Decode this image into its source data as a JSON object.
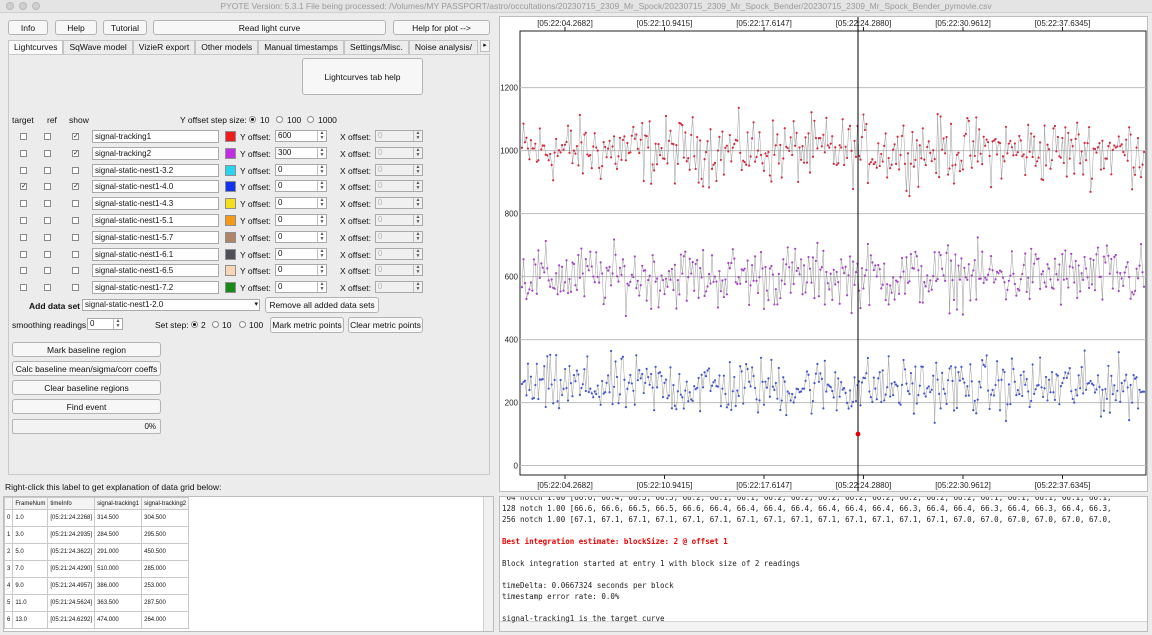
{
  "window": {
    "title": "PYOTE Version: 5.3.1  File being processed: /Volumes/MY PASSPORT/astro/occultations/20230715_2309_Mr_Spock/20230715_2309_Mr_Spock_Bender/20230715_2309_Mr_Spock_Bender_pymovie.csv"
  },
  "toolbar": {
    "info": "Info",
    "help": "Help",
    "tutorial": "Tutorial",
    "read_light_curve": "Read light curve",
    "help_for_plot": "Help for plot -->"
  },
  "tabs": [
    "Lightcurves",
    "SqWave model",
    "VizieR export",
    "Other models",
    "Manual timestamps",
    "Settings/Misc.",
    "Noise analysis/"
  ],
  "lightcurves": {
    "tab_help": "Lightcurves tab help",
    "col_target": "target",
    "col_ref": "ref",
    "col_show": "show",
    "y_offset_step_label": "Y offset step size:",
    "y_step_options": [
      "10",
      "100",
      "1000"
    ],
    "y_step_selected": "10",
    "y_offset_label": "Y offset:",
    "x_offset_label": "X offset:",
    "rows": [
      {
        "name": "signal-tracking1",
        "color": "#ee1c1c",
        "target": false,
        "ref": false,
        "show": true,
        "y_offset": "600",
        "x_offset": "0"
      },
      {
        "name": "signal-tracking2",
        "color": "#c22ee6",
        "target": false,
        "ref": false,
        "show": true,
        "y_offset": "300",
        "x_offset": "0"
      },
      {
        "name": "signal-static-nest1-3.2",
        "color": "#2bd4ee",
        "target": false,
        "ref": false,
        "show": false,
        "y_offset": "0",
        "x_offset": "0"
      },
      {
        "name": "signal-static-nest1-4.0",
        "color": "#1233ee",
        "target": true,
        "ref": false,
        "show": true,
        "y_offset": "0",
        "x_offset": "0"
      },
      {
        "name": "signal-static-nest1-4.3",
        "color": "#f5df1c",
        "target": false,
        "ref": false,
        "show": false,
        "y_offset": "0",
        "x_offset": "0"
      },
      {
        "name": "signal-static-nest1-5.1",
        "color": "#f59a18",
        "target": false,
        "ref": false,
        "show": false,
        "y_offset": "0",
        "x_offset": "0"
      },
      {
        "name": "signal-static-nest1-5.7",
        "color": "#b08467",
        "target": false,
        "ref": false,
        "show": false,
        "y_offset": "0",
        "x_offset": "0"
      },
      {
        "name": "signal-static-nest1-6.1",
        "color": "#4d5057",
        "target": false,
        "ref": false,
        "show": false,
        "y_offset": "0",
        "x_offset": "0"
      },
      {
        "name": "signal-static-nest1-6.5",
        "color": "#f8d6b6",
        "target": false,
        "ref": false,
        "show": false,
        "y_offset": "0",
        "x_offset": "0"
      },
      {
        "name": "signal-static-nest1-7.2",
        "color": "#178a17",
        "target": false,
        "ref": false,
        "show": false,
        "y_offset": "0",
        "x_offset": "0"
      }
    ],
    "add_data_set_label": "Add data set",
    "add_data_set_value": "signal-static-nest1-2.0",
    "remove_all": "Remove all added data sets",
    "smoothing_label": "smoothing readings",
    "smoothing_value": "0",
    "set_step_label": "Set step:",
    "set_step_options": [
      "2",
      "10",
      "100"
    ],
    "set_step_selected": "2",
    "mark_metric": "Mark metric points",
    "clear_metric": "Clear metric points",
    "mark_baseline": "Mark baseline region",
    "calc_baseline": "Calc baseline mean/sigma/corr coeffs",
    "clear_baseline": "Clear baseline regions",
    "find_event": "Find event",
    "progress": "0%",
    "progress_fraction": 0
  },
  "data_grid": {
    "header_label": "Right-click this label to get explanation of data grid below:",
    "columns": [
      "FrameNum",
      "timeInfo",
      "signal-tracking1",
      "signal-tracking2"
    ],
    "rows": [
      [
        "0",
        "1.0",
        "[05:21:24.2268]",
        "314.500",
        "304.500"
      ],
      [
        "1",
        "3.0",
        "[05:21:24.2935]",
        "284.500",
        "295.500"
      ],
      [
        "2",
        "5.0",
        "[05:21:24.3622]",
        "291.000",
        "450.500"
      ],
      [
        "3",
        "7.0",
        "[05:21:24.4290]",
        "510.000",
        "285.000"
      ],
      [
        "4",
        "9.0",
        "[05:21:24.4957]",
        "386.000",
        "253.000"
      ],
      [
        "5",
        "11.0",
        "[05:21:24.5624]",
        "363.500",
        "287.500"
      ],
      [
        "6",
        "13.0",
        "[05:21:24.6292]",
        "474.000",
        "264.000"
      ]
    ]
  },
  "log": {
    "lines": [
      " 64 notch 1.00 [66.6, 66.4, 66.5, 66.5, 66.2, 66.1, 66.1, 66.2, 66.2, 66.2, 66.2, 66.2, 66.2, 66.2, 66.2, 66.1, 66.1, 66.1, 66.1, 66.1,",
      "128 notch 1.00 [66.6, 66.6, 66.5, 66.5, 66.6, 66.4, 66.4, 66.4, 66.4, 66.4, 66.4, 66.4, 66.3, 66.4, 66.4, 66.3, 66.4, 66.3, 66.4, 66.3,",
      "256 notch 1.00 [67.1, 67.1, 67.1, 67.1, 67.1, 67.1, 67.1, 67.1, 67.1, 67.1, 67.1, 67.1, 67.1, 67.1, 67.0, 67.0, 67.0, 67.0, 67.0, 67.0,",
      "",
      "Best integration estimate: blockSize: 2 @ offset 1",
      "",
      "Block integration started at entry 1 with block size of 2 readings",
      "",
      "timeDelta: 0.0667324 seconds per block",
      "timestamp error rate: 0.0%",
      "",
      "signal-tracking1 is the target curve"
    ]
  },
  "chart_data": {
    "type": "scatter",
    "x_tick_labels": [
      "[05:22:04.2682]",
      "[05:22:10.9415]",
      "[05:22:17.6147]",
      "[05:22:24.2880]",
      "[05:22:30.9612]",
      "[05:22:37.6345]"
    ],
    "y_ticks": [
      0,
      200,
      400,
      600,
      800,
      1000,
      1200
    ],
    "ylim": [
      -30,
      1380
    ],
    "grid": true,
    "series": [
      {
        "color": "#d9263a",
        "mean": 1000,
        "spread": 95
      },
      {
        "color": "#a83fc9",
        "mean": 600,
        "spread": 90
      },
      {
        "color": "#3f55d4",
        "mean": 250,
        "spread": 85
      }
    ],
    "cursor_label": "[05:22:24.2880]",
    "marker_point": {
      "y": 100,
      "color": "#e00000"
    }
  }
}
